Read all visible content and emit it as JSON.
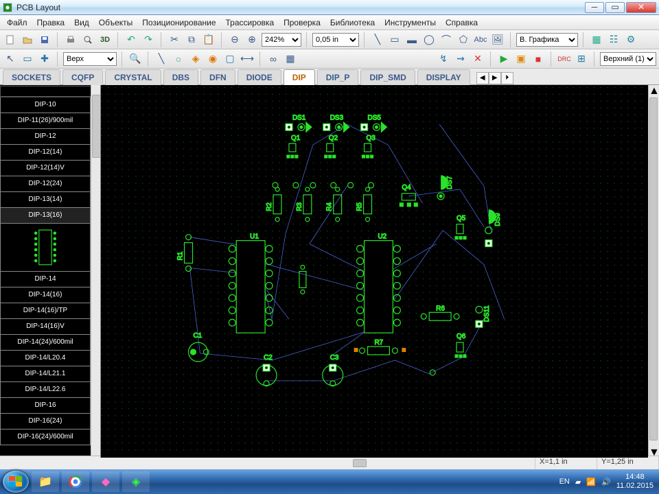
{
  "window": {
    "title": "PCB Layout"
  },
  "menu": [
    "Файл",
    "Правка",
    "Вид",
    "Объекты",
    "Позиционирование",
    "Трассировка",
    "Проверка",
    "Библиотека",
    "Инструменты",
    "Справка"
  ],
  "toolbar1": {
    "btn3d": "3D",
    "zoom_sel": "242%",
    "grid_sel": "0,05 in",
    "abc": "Abc",
    "layer_view": "В. Графика"
  },
  "toolbar2": {
    "layer_sel": "Верх",
    "side_sel": "Верхний (1)"
  },
  "tabs": {
    "items": [
      "SOCKETS",
      "CQFP",
      "CRYSTAL",
      "DBS",
      "DFN",
      "DIODE",
      "DIP",
      "DIP_P",
      "DIP_SMD",
      "DISPLAY"
    ],
    "active_index": 6
  },
  "sidebar": {
    "search": "",
    "items": [
      "DIP-10",
      "DIP-11(26)/900mil",
      "DIP-12",
      "DIP-12(14)",
      "DIP-12(14)V",
      "DIP-12(24)",
      "DIP-13(14)",
      "DIP-13(16)",
      "_preview",
      "DIP-14",
      "DIP-14(16)",
      "DIP-14(16)/TP",
      "DIP-14(16)V",
      "DIP-14(24)/600mil",
      "DIP-14/L20.4",
      "DIP-14/L21.1",
      "DIP-14/L22.6",
      "DIP-16",
      "DIP-16(24)",
      "DIP-16(24)/600mil"
    ],
    "selected_index": 7
  },
  "canvas": {
    "refdes": [
      "DS1",
      "DS3",
      "DS5",
      "Q1",
      "Q2",
      "Q3",
      "Q4",
      "Q5",
      "Q6",
      "R1",
      "R2",
      "R3",
      "R4",
      "R5",
      "R6",
      "R7",
      "U1",
      "U2",
      "C1",
      "C2",
      "C3",
      "DS7",
      "DS9",
      "DS11"
    ]
  },
  "status": {
    "x": "X=1,1 in",
    "y": "Y=1,25 in"
  },
  "taskbar": {
    "lang": "EN",
    "time": "14:48",
    "date": "11.02.2015"
  }
}
